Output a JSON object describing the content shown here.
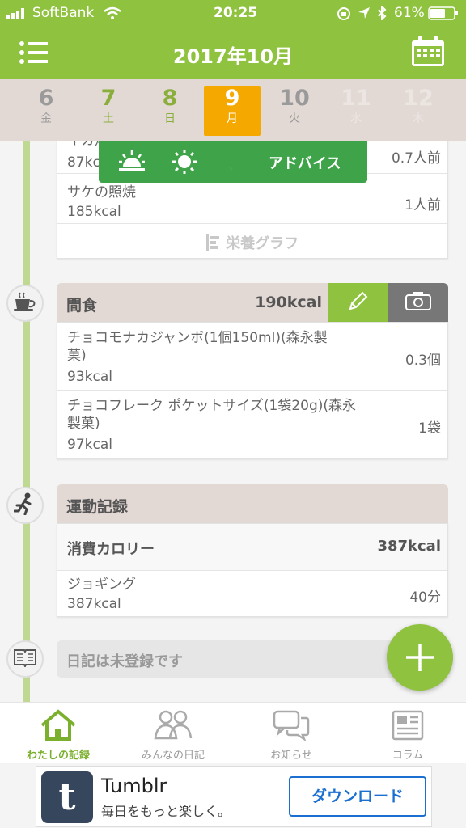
{
  "status_bar": {
    "carrier": "SoftBank",
    "time": "20:25",
    "battery": "61%"
  },
  "header": {
    "title": "2017年10月"
  },
  "days": [
    {
      "num": "6",
      "weekday": "金",
      "state": "past"
    },
    {
      "num": "7",
      "weekday": "土",
      "state": "green"
    },
    {
      "num": "8",
      "weekday": "日",
      "state": "green"
    },
    {
      "num": "9",
      "weekday": "月",
      "state": "selected"
    },
    {
      "num": "10",
      "weekday": "火",
      "state": "past"
    },
    {
      "num": "11",
      "weekday": "水",
      "state": "future"
    },
    {
      "num": "12",
      "weekday": "木",
      "state": "future"
    }
  ],
  "advice_bar": {
    "label": "アドバイス"
  },
  "meal_prev": {
    "items": [
      {
        "name": "イカ焼",
        "kcal": "87kcal",
        "amount": "0.7人前"
      },
      {
        "name": "サケの照焼",
        "kcal": "185kcal",
        "amount": "1人前"
      }
    ],
    "graph_link": "栄養グラフ"
  },
  "snack": {
    "label": "間食",
    "kcal": "190kcal",
    "items": [
      {
        "name": "チョコモナカジャンボ(1個150ml)(森永製菓)",
        "kcal": "93kcal",
        "amount": "0.3個"
      },
      {
        "name": "チョコフレーク ポケットサイズ(1袋20g)(森永製菓)",
        "kcal": "97kcal",
        "amount": "1袋"
      }
    ]
  },
  "exercise": {
    "label": "運動記録",
    "consumed_label": "消費カロリー",
    "consumed_value": "387kcal",
    "items": [
      {
        "name": "ジョギング",
        "kcal": "387kcal",
        "amount": "40分"
      }
    ]
  },
  "diary": {
    "placeholder": "日記は未登録です"
  },
  "tabs": [
    {
      "label": "わたしの記録",
      "active": true
    },
    {
      "label": "みんなの日記",
      "active": false
    },
    {
      "label": "お知らせ",
      "active": false
    },
    {
      "label": "コラム",
      "active": false
    }
  ],
  "ad": {
    "title": "Tumblr",
    "subtitle": "毎日をもっと楽しく。",
    "button": "ダウンロード"
  },
  "colors": {
    "brand_green": "#8fc23e",
    "selected_day": "#f5a800",
    "advice_green": "#3fa349"
  }
}
